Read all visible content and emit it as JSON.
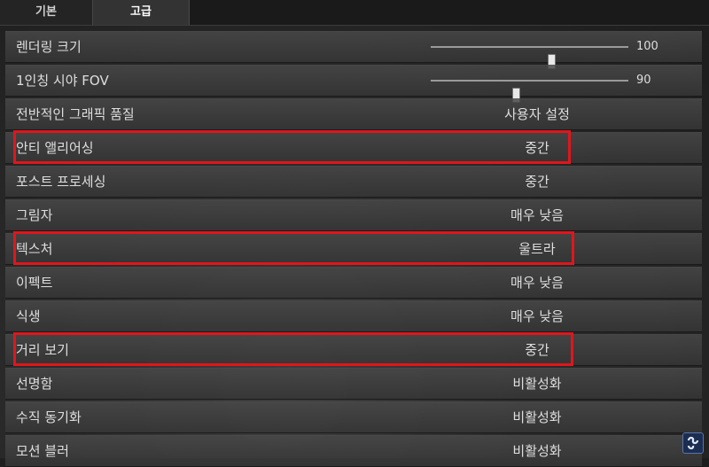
{
  "tabs": [
    {
      "label": "기본",
      "active": false
    },
    {
      "label": "고급",
      "active": true
    }
  ],
  "settings": [
    {
      "label": "렌더링 크기",
      "type": "slider",
      "value": "100",
      "level": 0.61
    },
    {
      "label": "1인칭 시야 FOV",
      "type": "slider",
      "value": "90",
      "level": 0.43
    },
    {
      "label": "전반적인 그래픽 품질",
      "type": "option",
      "value": "사용자 설정"
    },
    {
      "label": "안티 앨리어싱",
      "type": "option",
      "value": "중간",
      "highlighted": true
    },
    {
      "label": "포스트 프로세싱",
      "type": "option",
      "value": "중간"
    },
    {
      "label": "그림자",
      "type": "option",
      "value": "매우 낮음"
    },
    {
      "label": "텍스처",
      "type": "option",
      "value": "울트라",
      "highlighted": true
    },
    {
      "label": "이펙트",
      "type": "option",
      "value": "매우 낮음"
    },
    {
      "label": "식생",
      "type": "option",
      "value": "매우 낮음"
    },
    {
      "label": "거리 보기",
      "type": "option",
      "value": "중간",
      "highlighted": true
    },
    {
      "label": "선명함",
      "type": "option",
      "value": "비활성화"
    },
    {
      "label": "수직 동기화",
      "type": "option",
      "value": "비활성화"
    },
    {
      "label": "모션 블러",
      "type": "option",
      "value": "비활성화"
    }
  ],
  "colors": {
    "highlight": "#e0161c",
    "background": "#2c2c2c",
    "row": "#444444",
    "text": "#dedede"
  },
  "watermark_icon": "logo-icon"
}
